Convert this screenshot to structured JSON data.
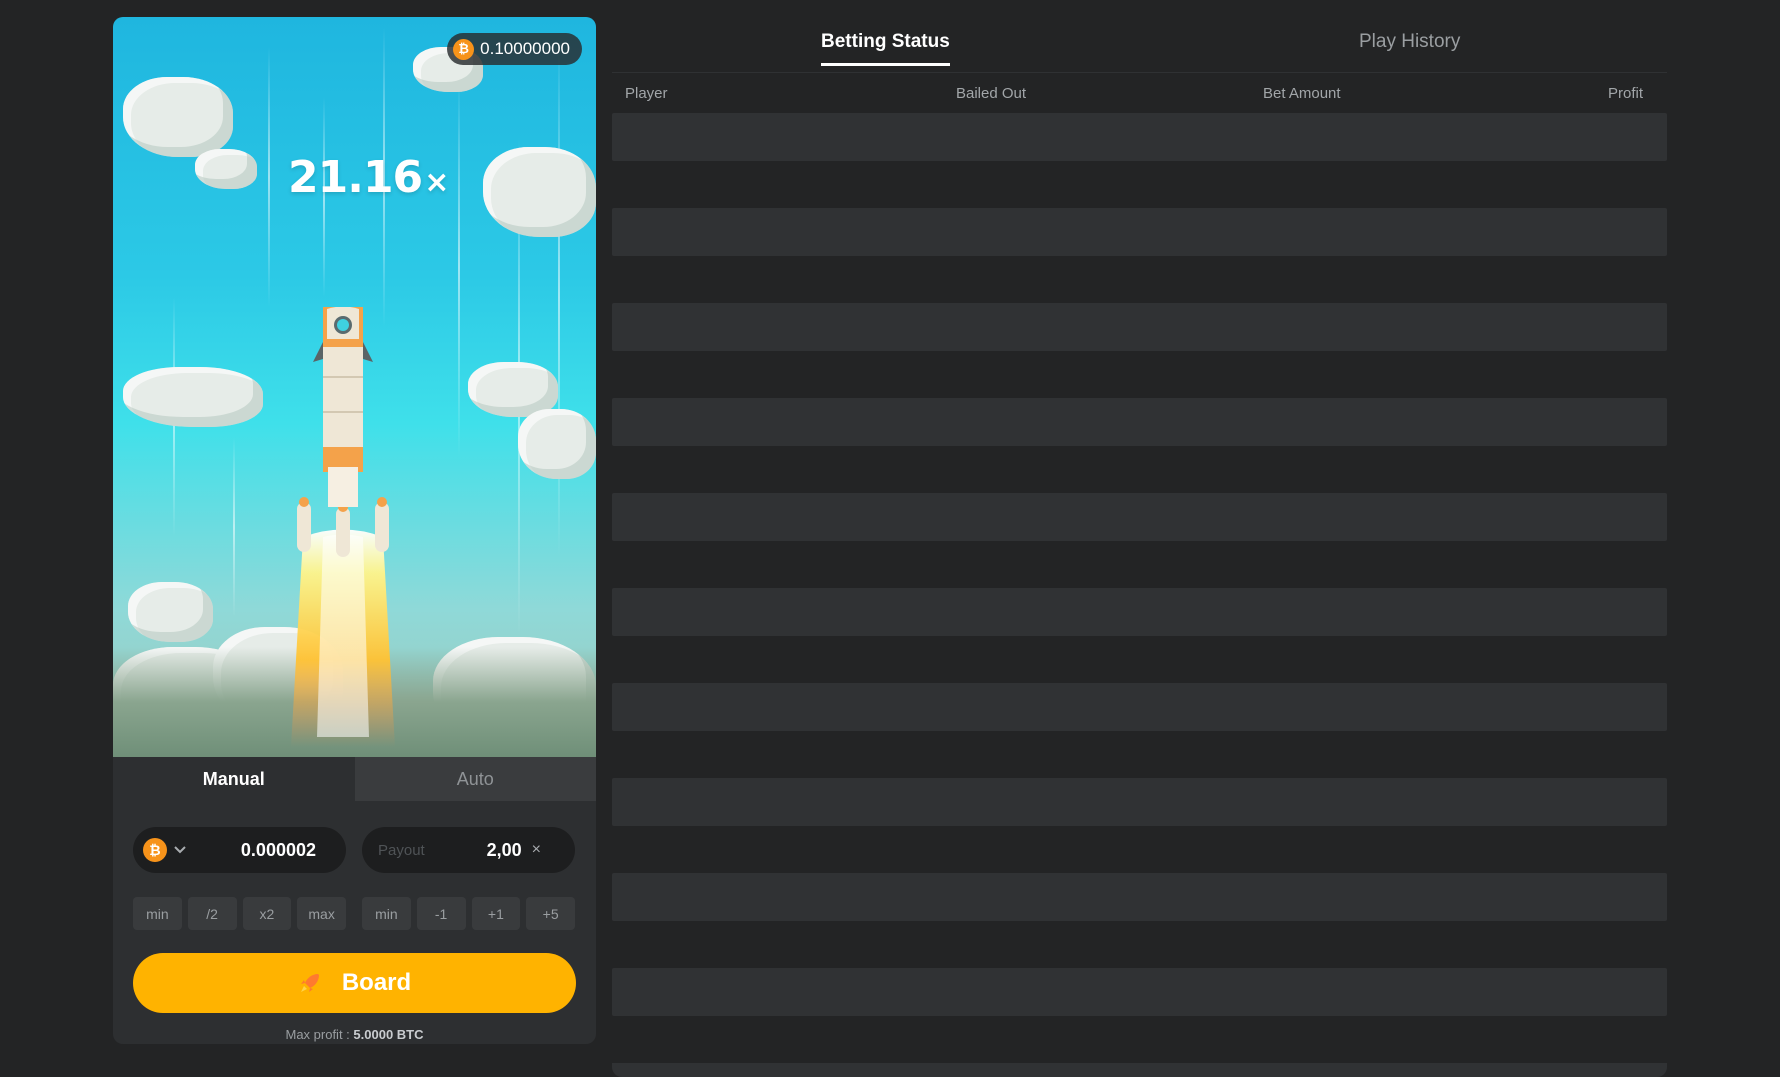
{
  "game": {
    "balance": "0.10000000",
    "currency_symbol": "₿",
    "multiplier": "21.16",
    "multiplier_suffix": "×"
  },
  "mode_tabs": [
    {
      "label": "Manual",
      "active": true
    },
    {
      "label": "Auto",
      "active": false
    }
  ],
  "bet": {
    "amount": "0.000002",
    "currency": "BTC",
    "chevron": "chevron-down-icon",
    "quick_buttons": [
      "min",
      "/2",
      "x2",
      "max"
    ]
  },
  "payout": {
    "label": "Payout",
    "value": "2,00",
    "suffix": "×",
    "quick_buttons": [
      "min",
      "-1",
      "+1",
      "+5"
    ]
  },
  "board_button": {
    "label": "Board",
    "icon": "rocket-icon"
  },
  "max_profit": {
    "label": "Max profit :",
    "value": "5.0000 BTC"
  },
  "status_tabs": [
    {
      "label": "Betting Status",
      "active": true
    },
    {
      "label": "Play History",
      "active": false
    }
  ],
  "table": {
    "columns": [
      "Player",
      "Bailed Out",
      "Bet Amount",
      "Profit"
    ],
    "rows": []
  },
  "colors": {
    "accent": "#ffb300",
    "bitcoin": "#f7931a",
    "background": "#232425",
    "panel": "#2d2f31"
  }
}
